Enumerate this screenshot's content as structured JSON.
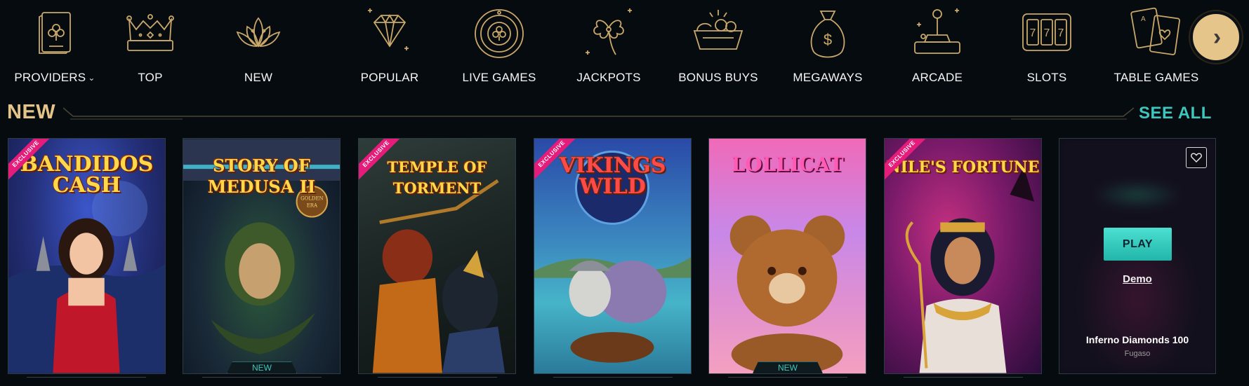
{
  "nav": {
    "items": [
      {
        "label": "PROVIDERS",
        "icon": "card-clover-icon",
        "has_dropdown": true
      },
      {
        "label": "TOP",
        "icon": "crown-icon"
      },
      {
        "label": "NEW",
        "icon": "lotus-icon"
      },
      {
        "label": "POPULAR",
        "icon": "diamond-icon"
      },
      {
        "label": "LIVE GAMES",
        "icon": "roulette-icon"
      },
      {
        "label": "JACKPOTS",
        "icon": "clover-icon"
      },
      {
        "label": "BONUS BUYS",
        "icon": "basket-icon"
      },
      {
        "label": "MEGAWAYS",
        "icon": "money-bag-icon"
      },
      {
        "label": "ARCADE",
        "icon": "joystick-icon"
      },
      {
        "label": "SLOTS",
        "icon": "slot-machine-icon"
      },
      {
        "label": "TABLE GAMES",
        "icon": "playing-cards-icon"
      }
    ],
    "next_icon": "chevron-right-icon"
  },
  "section": {
    "title": "NEW",
    "see_all": "SEE ALL"
  },
  "games": [
    {
      "title": "BANDIDOS CASH",
      "exclusive": true,
      "badge": ""
    },
    {
      "title": "STORY OF MEDUSA II",
      "exclusive": false,
      "badge": "NEW",
      "corner_logo": "GOLDEN ERA"
    },
    {
      "title": "TEMPLE OF TORMENT",
      "exclusive": true,
      "badge": ""
    },
    {
      "title": "VIKINGS WILD",
      "exclusive": true,
      "badge": ""
    },
    {
      "title": "LOLLICAT",
      "exclusive": false,
      "badge": "NEW"
    },
    {
      "title": "NILE'S FORTUNE",
      "exclusive": true,
      "badge": ""
    }
  ],
  "exclusive_label": "EXCLUSIVE",
  "hover_card": {
    "play_label": "PLAY",
    "demo_label": "Demo",
    "name": "Inferno Diamonds 100",
    "provider": "Fugaso",
    "fav_icon": "heart-icon"
  },
  "colors": {
    "gold": "#e5c48a",
    "teal": "#3dc7bd",
    "background": "#060b10",
    "exclusive": "#e61c7a"
  }
}
